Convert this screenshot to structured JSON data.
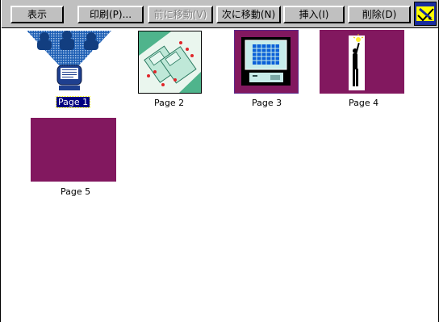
{
  "toolbar": {
    "buttons": [
      {
        "label": "表示",
        "enabled": true
      },
      {
        "label": "印刷(P)...",
        "enabled": true
      },
      {
        "label": "前に移動(V)",
        "enabled": false
      },
      {
        "label": "次に移動(N)",
        "enabled": true
      },
      {
        "label": "挿入(I)",
        "enabled": true
      },
      {
        "label": "削除(D)",
        "enabled": true
      }
    ],
    "wizard_icon": "pencil-check-icon"
  },
  "pages": [
    {
      "label": "Page 1",
      "selected": true,
      "thumbnail": "computer-audience-image"
    },
    {
      "label": "Page 2",
      "selected": false,
      "thumbnail": "floppy-disks-image"
    },
    {
      "label": "Page 3",
      "selected": false,
      "thumbnail": "computer-monitor-image"
    },
    {
      "label": "Page 4",
      "selected": false,
      "thumbnail": "figure-lightbulb-image"
    },
    {
      "label": "Page 5",
      "selected": false,
      "thumbnail": "blank-purple-image"
    }
  ],
  "colors": {
    "page_purple": "#82185f",
    "toolbar_gray": "#c0c0c0",
    "selection_blue": "#000080"
  }
}
